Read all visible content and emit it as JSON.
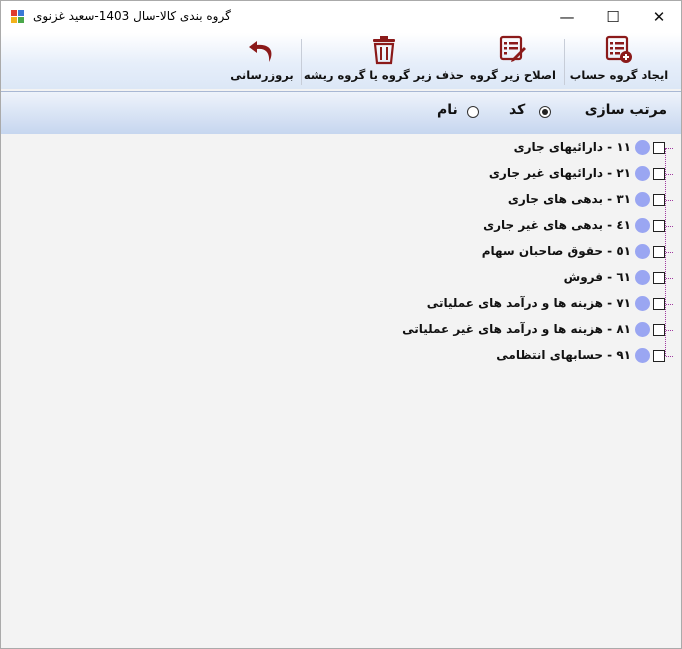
{
  "window": {
    "title": "گروه بندی کالا-سال 1403-سعید غزنوی",
    "minimize_glyph": "—",
    "maximize_glyph": "☐",
    "close_glyph": "✕"
  },
  "toolbar": {
    "create_label": "ایجاد گروه حساب",
    "edit_label": "اصلاح زیر گروه",
    "delete_label": "حذف زیر گروه یا گروه ریشه",
    "refresh_label": "بروزرسانی"
  },
  "sort": {
    "label": "مرتب سازی",
    "code_label": "کد",
    "name_label": "نام",
    "selected": "code"
  },
  "tree": {
    "items": [
      {
        "code": "١١",
        "name": "دارائیهای جاری",
        "text": "١١ - دارائیهای جاری"
      },
      {
        "code": "٢١",
        "name": "دارائیهای غیر جاری",
        "text": "٢١ - دارائیهای غیر جاری"
      },
      {
        "code": "٣١",
        "name": "بدهی های جاری",
        "text": "٣١ - بدهی های جاری"
      },
      {
        "code": "٤١",
        "name": "بدهی های غیر جاری",
        "text": "٤١ - بدهی های غیر جاری"
      },
      {
        "code": "٥١",
        "name": "حقوق صاحبان سهام",
        "text": "٥١ - حقوق صاحبان سهام"
      },
      {
        "code": "٦١",
        "name": "فروش",
        "text": "٦١ - فروش"
      },
      {
        "code": "٧١",
        "name": "هزینه ها و درآمد های عملیاتی",
        "text": "٧١ - هزینه ها و درآمد های عملیاتی"
      },
      {
        "code": "٨١",
        "name": "هزینه ها و درآمد های غیر عملیاتی",
        "text": "٨١ - هزینه ها و درآمد های غیر عملیاتی"
      },
      {
        "code": "٩١",
        "name": "حسابهای انتظامی",
        "text": "٩١ - حسابهای انتظامی"
      }
    ]
  },
  "colors": {
    "icon_dark_red": "#8b1a1a",
    "tree_node": "#9aa6f2",
    "tree_line": "#a03aa0"
  }
}
